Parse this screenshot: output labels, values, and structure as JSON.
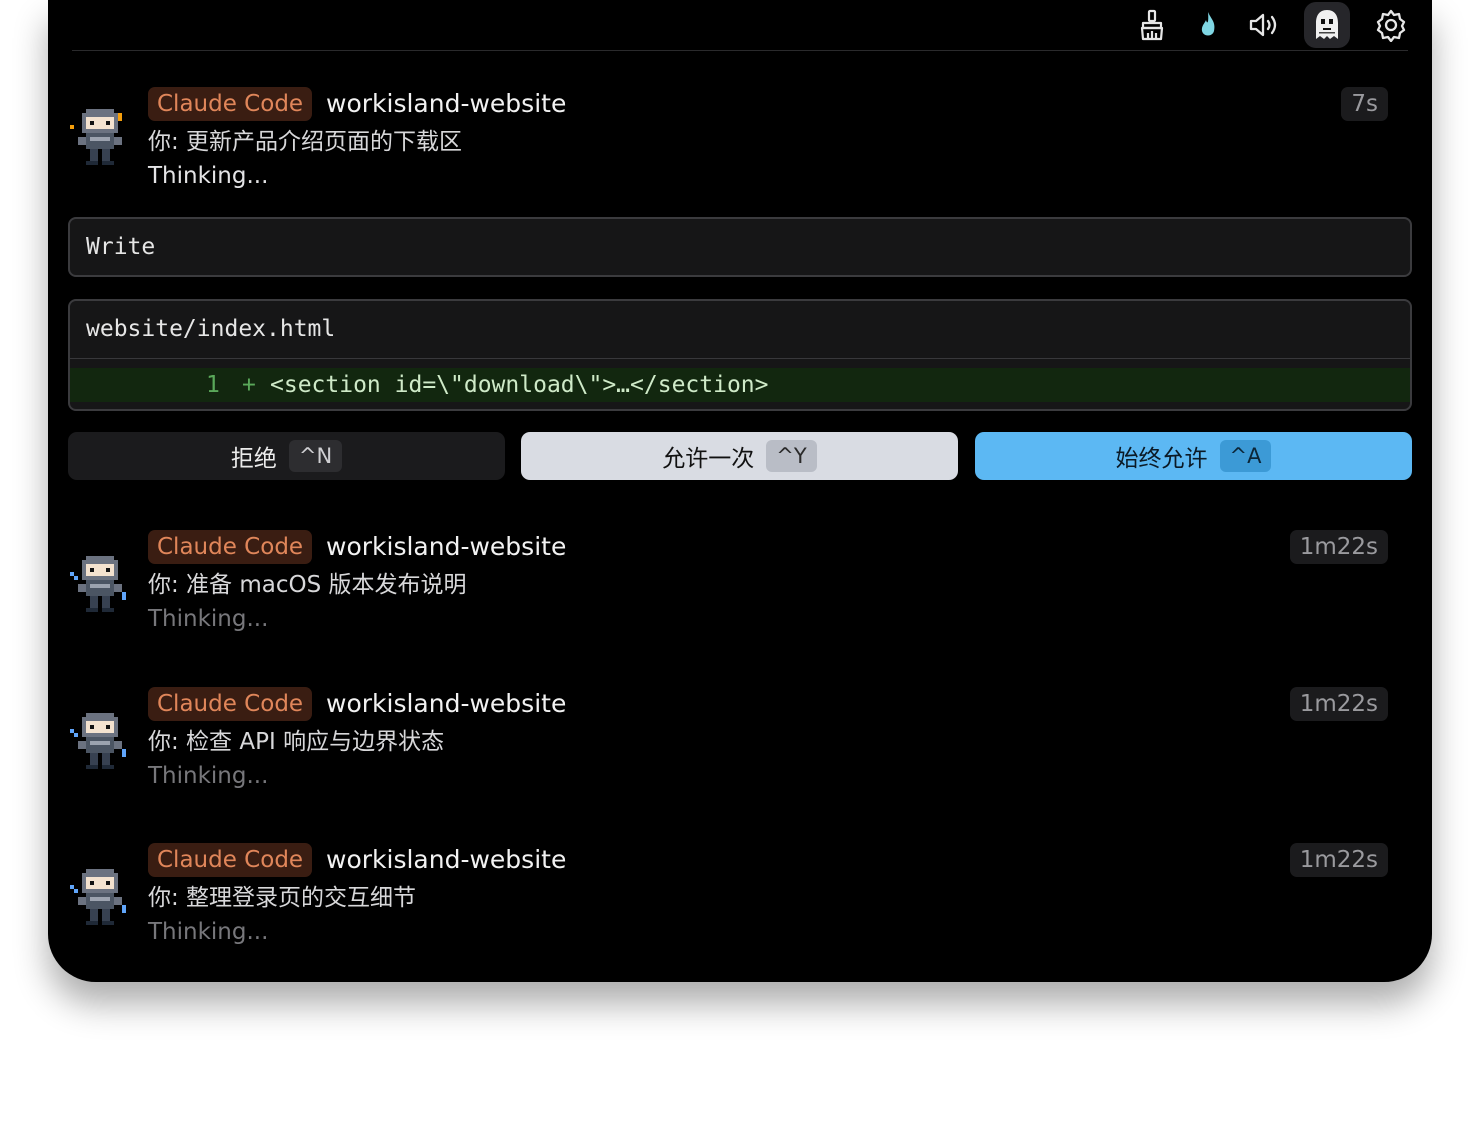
{
  "toolbar": {
    "icons": [
      "broom-icon",
      "flame-icon",
      "volume-icon",
      "ghost-avatar-icon",
      "settings-gear-icon"
    ],
    "active_icon": "ghost-avatar-icon"
  },
  "active_session": {
    "agent": "Claude Code",
    "project": "workisland-website",
    "elapsed": "7s",
    "prompt": "你: 更新产品介绍页面的下载区",
    "status": "Thinking..."
  },
  "permission_request": {
    "tool": "Write",
    "file_path": "website/index.html",
    "diff": [
      {
        "line": "1",
        "sign": "+",
        "code": "<section id=\\\"download\\\">…</section>"
      }
    ]
  },
  "actions": {
    "deny": {
      "label": "拒绝",
      "shortcut": "^N"
    },
    "allow_once": {
      "label": "允许一次",
      "shortcut": "^Y"
    },
    "always_allow": {
      "label": "始终允许",
      "shortcut": "^A"
    }
  },
  "sessions": [
    {
      "agent": "Claude Code",
      "project": "workisland-website",
      "elapsed": "1m22s",
      "prompt": "你: 准备 macOS 版本发布说明",
      "status": "Thinking..."
    },
    {
      "agent": "Claude Code",
      "project": "workisland-website",
      "elapsed": "1m22s",
      "prompt": "你: 检查 API 响应与边界状态",
      "status": "Thinking..."
    },
    {
      "agent": "Claude Code",
      "project": "workisland-website",
      "elapsed": "1m22s",
      "prompt": "你: 整理登录页的交互细节",
      "status": "Thinking..."
    }
  ],
  "colors": {
    "agent_badge_bg": "#3a1d12",
    "agent_badge_text": "#e0865a",
    "always_allow_bg": "#5cb8f3",
    "diff_add_bg": "#12270f"
  }
}
